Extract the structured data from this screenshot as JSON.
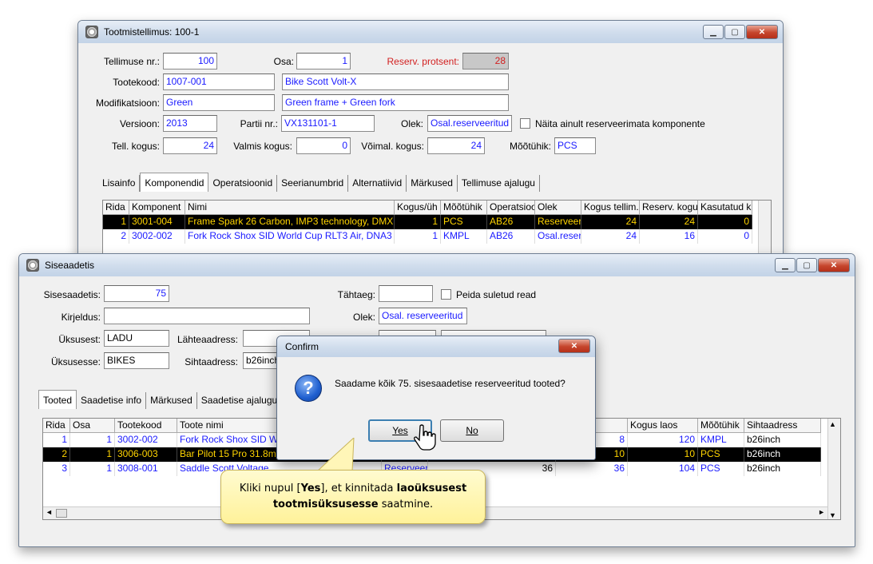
{
  "prod_window": {
    "title": "Tootmistellimus: 100-1",
    "fields": {
      "tellimuse_nr": {
        "label": "Tellimuse nr.:",
        "value": "100"
      },
      "osa": {
        "label": "Osa:",
        "value": "1"
      },
      "reserv_protsent": {
        "label": "Reserv. protsent:",
        "value": "28"
      },
      "tootekood": {
        "label": "Tootekood:",
        "value": "1007-001",
        "desc": "Bike Scott Volt-X"
      },
      "modifikatsioon": {
        "label": "Modifikatsioon:",
        "value": "Green",
        "desc": "Green frame + Green fork"
      },
      "versioon": {
        "label": "Versioon:",
        "value": "2013"
      },
      "partii_nr": {
        "label": "Partii nr.:",
        "value": "VX131101-1"
      },
      "olek": {
        "label": "Olek:",
        "value": "Osal.reserveeritud"
      },
      "naita_checkbox_label": "Näita ainult reserveerimata komponente",
      "tell_kogus": {
        "label": "Tell. kogus:",
        "value": "24"
      },
      "valmis_kogus": {
        "label": "Valmis kogus:",
        "value": "0"
      },
      "voimal_kogus": {
        "label": "Võimal. kogus:",
        "value": "24"
      },
      "mootuhik": {
        "label": "Mõõtühik:",
        "value": "PCS"
      }
    },
    "tabs": [
      "Lisainfo",
      "Komponendid",
      "Operatsioonid",
      "Seerianumbrid",
      "Alternatiivid",
      "Märkused",
      "Tellimuse ajalugu"
    ],
    "active_tab": "Komponendid",
    "grid": {
      "columns": [
        "Rida",
        "Komponent",
        "Nimi",
        "Kogus/üh",
        "Mõõtühik",
        "Operatsioo",
        "Olek",
        "Kogus tellim.",
        "Reserv. kogu",
        "Kasutatud k"
      ],
      "rows": [
        [
          "1",
          "3001-004",
          "Frame Spark 26 Carbon, IMP3 technology, DMX",
          "1",
          "PCS",
          "AB26",
          "Reserveeri",
          "24",
          "24",
          "0"
        ],
        [
          "2",
          "3002-002",
          "Fork Rock Shox SID World Cup RLT3 Air, DNA3",
          "1",
          "KMPL",
          "AB26",
          "Osal.reserv",
          "24",
          "16",
          "0"
        ]
      ]
    }
  },
  "shipment_window": {
    "title": "Siseaadetis",
    "fields": {
      "sisesaadetis": {
        "label": "Sisesaadetis:",
        "value": "75"
      },
      "tahtaeg": {
        "label": "Tähtaeg:",
        "value": ""
      },
      "peida_label": "Peida suletud read",
      "kirjeldus": {
        "label": "Kirjeldus:",
        "value": ""
      },
      "olek": {
        "label": "Olek:",
        "value": "Osal. reserveeritud"
      },
      "uksusest": {
        "label": "Üksusest:",
        "value": "LADU"
      },
      "lahteaadress": {
        "label": "Lähteaadress:",
        "value": ""
      },
      "uksusesse": {
        "label": "Üksusesse:",
        "value": "BIKES"
      },
      "sihtaadress": {
        "label": "Sihtaadress:",
        "value": "b26inch"
      }
    },
    "tabs": [
      "Tooted",
      "Saadetise info",
      "Märkused",
      "Saadetise ajalugu"
    ],
    "active_tab": "Tooted",
    "grid": {
      "columns": [
        "Rida",
        "Osa",
        "Tootekood",
        "Toote nimi",
        "",
        "",
        "Kogus",
        "Kogus laos",
        "Mõõtühik",
        "Sihtaadress"
      ],
      "rows": [
        [
          "1",
          "1",
          "3002-002",
          "Fork Rock Shox SID W",
          "",
          "",
          "8",
          "120",
          "KMPL",
          "b26inch"
        ],
        [
          "2",
          "1",
          "3006-003",
          "Bar Pilot 15 Pro 31.8mm",
          "",
          "",
          "10",
          "10",
          "PCS",
          "b26inch"
        ],
        [
          "3",
          "1",
          "3008-001",
          "Saddle Scott Voltage",
          "Reserveeritu",
          "36",
          "36",
          "104",
          "PCS",
          "b26inch"
        ]
      ]
    }
  },
  "confirm_dialog": {
    "title": "Confirm",
    "message": "Saadame kõik 75. sisesaadetise reserveeritud tooted?",
    "yes_label": "Yes",
    "no_label": "No"
  },
  "callout": {
    "part1": "Kliki nupul [",
    "yes": "Yes",
    "part2": "], et kinnitada ",
    "bold1": "laoüksusest tootmisüksusesse",
    "part3": " saatmine."
  }
}
